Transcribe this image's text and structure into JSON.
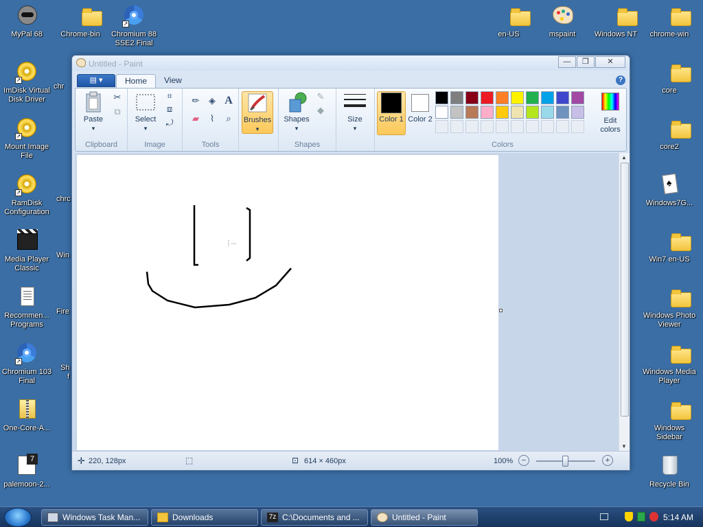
{
  "desktop_left": [
    {
      "label": "MyPal 68",
      "icon": "raccoon-icon"
    },
    {
      "label": "ImDisk Virtual Disk Driver",
      "icon": "disc-icon"
    },
    {
      "label": "Mount Image File",
      "icon": "disc-icon"
    },
    {
      "label": "RamDisk Configuration",
      "icon": "disc-icon"
    },
    {
      "label": "Media Player Classic",
      "icon": "clapper-icon"
    },
    {
      "label": "Recommen... Programs",
      "icon": "document-icon"
    },
    {
      "label": "Chromium 103 Final",
      "icon": "chromium-icon"
    },
    {
      "label": "One-Core-A...",
      "icon": "zip-icon"
    },
    {
      "label": "palemoon-2...",
      "icon": "archive-icon"
    }
  ],
  "desktop_left2": [
    {
      "label": "Chrome-bin",
      "icon": "folder-icon"
    },
    {
      "label": "Chromium 88 SSE2 Final",
      "icon": "chromium-icon"
    }
  ],
  "desktop_partial": [
    "chr",
    "chrc",
    "Win",
    "Fire",
    "Sh",
    "f"
  ],
  "desktop_top_right": [
    {
      "label": "en-US",
      "icon": "folder-icon"
    },
    {
      "label": "mspaint",
      "icon": "paint-icon"
    },
    {
      "label": "Windows NT",
      "icon": "folder-icon"
    },
    {
      "label": "chrome-win",
      "icon": "folder-icon"
    }
  ],
  "desktop_right": [
    {
      "label": "core",
      "icon": "folder-icon"
    },
    {
      "label": "core2",
      "icon": "folder-icon"
    },
    {
      "label": "Windows7G...",
      "icon": "card-icon"
    },
    {
      "label": "Win7 en-US",
      "icon": "folder-icon"
    },
    {
      "label": "Windows Photo Viewer",
      "icon": "folder-icon"
    },
    {
      "label": "Windows Media Player",
      "icon": "folder-icon"
    },
    {
      "label": "Windows Sidebar",
      "icon": "folder-icon"
    },
    {
      "label": "Recycle Bin",
      "icon": "recycle-bin-icon"
    }
  ],
  "window": {
    "title": "Untitled - Paint",
    "minimize": "—",
    "maximize": "❐",
    "close": "✕"
  },
  "tabs": {
    "home": "Home",
    "view": "View",
    "menu": "▤ ▾",
    "help": "?"
  },
  "ribbon": {
    "clipboard": {
      "label": "Clipboard",
      "paste": "Paste"
    },
    "image": {
      "label": "Image",
      "select": "Select"
    },
    "tools": {
      "label": "Tools"
    },
    "brushes": "Brushes",
    "shapes": {
      "label": "Shapes",
      "button": "Shapes"
    },
    "size": "Size",
    "color1": "Color 1",
    "color2": "Color 2",
    "colors_label": "Colors",
    "edit_colors": "Edit colors"
  },
  "palette_row1": [
    "#000000",
    "#7f7f7f",
    "#880015",
    "#ed1c24",
    "#ff7f27",
    "#fff200",
    "#22b14c",
    "#00a2e8",
    "#3f48cc",
    "#a349a4"
  ],
  "palette_row2": [
    "#ffffff",
    "#c3c3c3",
    "#b97a57",
    "#ffaec9",
    "#ffc90e",
    "#efe4b0",
    "#b5e61d",
    "#99d9ea",
    "#7092be",
    "#c8bfe7"
  ],
  "status": {
    "cursor_pos": "220, 128px",
    "canvas_size": "614 × 460px",
    "zoom": "100%"
  },
  "taskbar": {
    "items": [
      {
        "label": "Windows Task Man...",
        "icon": "task-manager-icon"
      },
      {
        "label": "Downloads",
        "icon": "folder-icon"
      },
      {
        "label": "C:\\Documents and ...",
        "icon": "7zip-icon"
      },
      {
        "label": "Untitled - Paint",
        "icon": "paint-icon"
      }
    ],
    "clock": "5:14 AM"
  }
}
